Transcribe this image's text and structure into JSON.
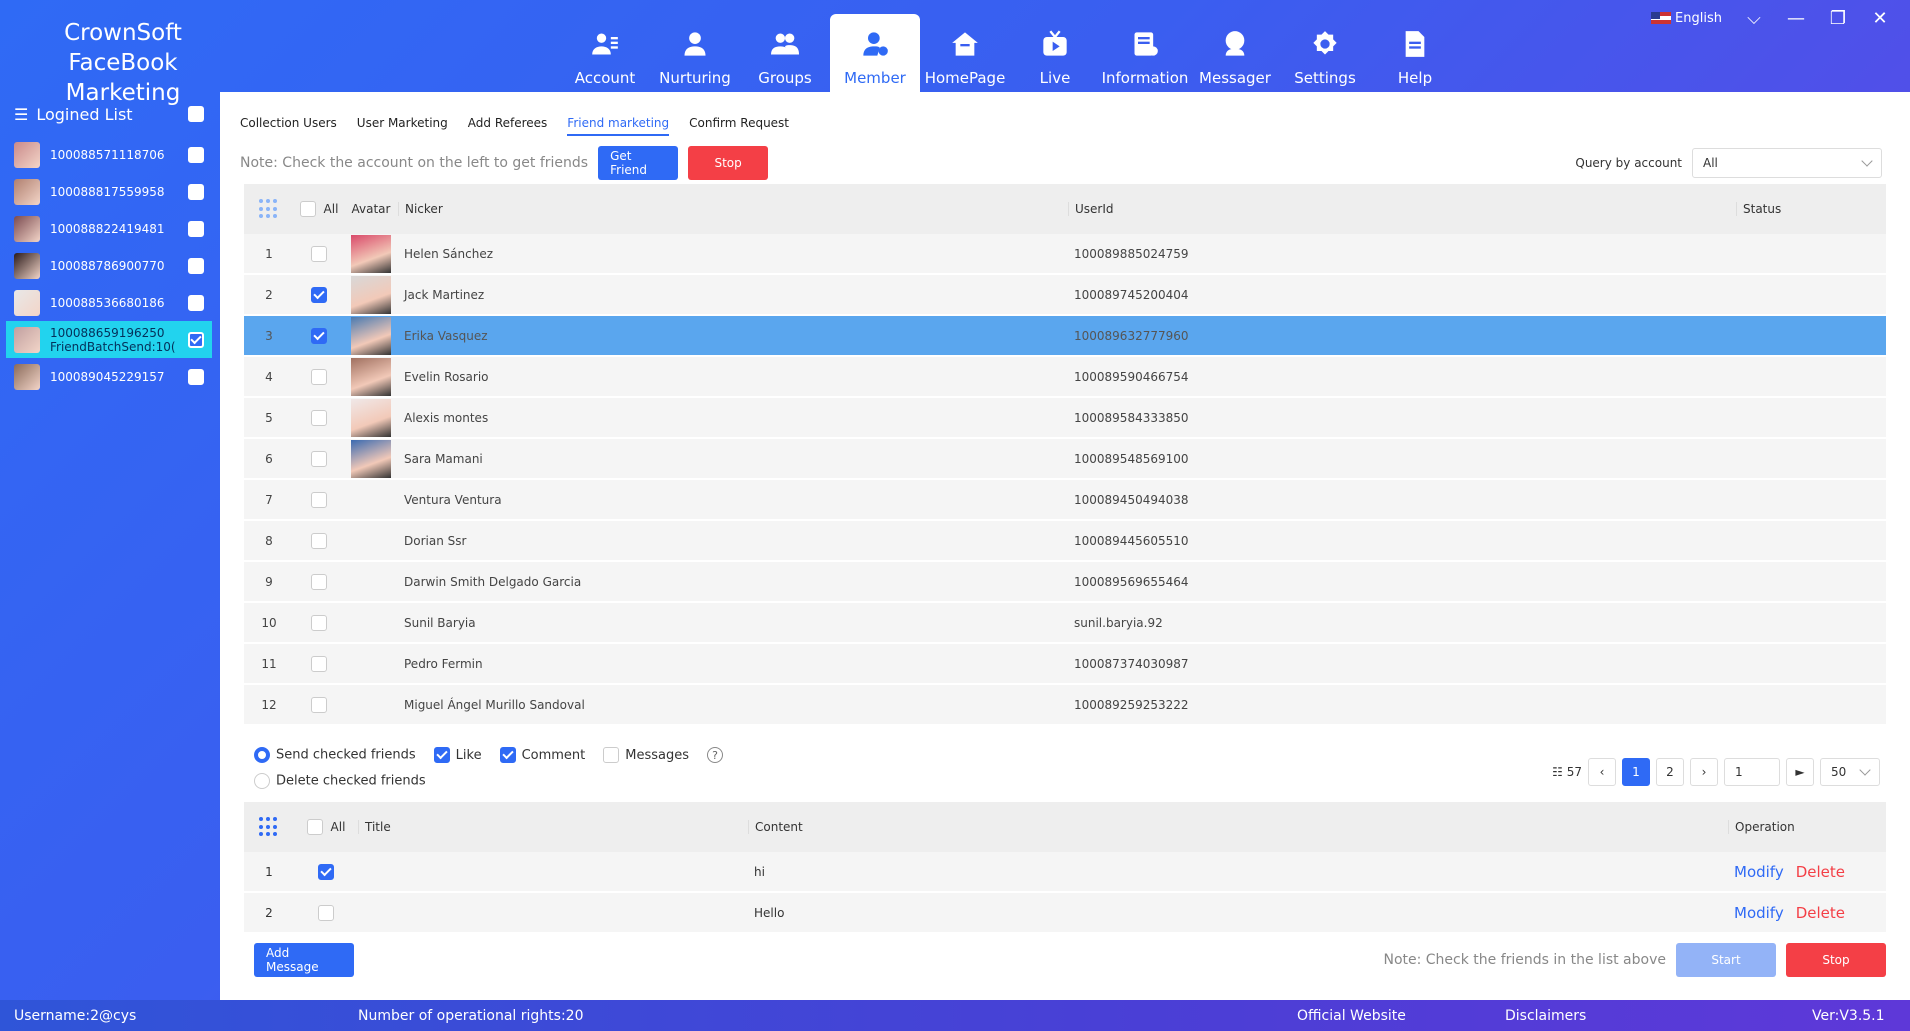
{
  "brand": {
    "line1": "CrownSoft",
    "line2": "FaceBook Marketing"
  },
  "nav": [
    {
      "label": "Account",
      "icon": "account-icon"
    },
    {
      "label": "Nurturing",
      "icon": "user-icon"
    },
    {
      "label": "Groups",
      "icon": "group-icon"
    },
    {
      "label": "Member",
      "icon": "member-icon",
      "active": true
    },
    {
      "label": "HomePage",
      "icon": "home-icon"
    },
    {
      "label": "Live",
      "icon": "live-icon"
    },
    {
      "label": "Information",
      "icon": "info-icon"
    },
    {
      "label": "Messager",
      "icon": "messenger-icon"
    },
    {
      "label": "Settings",
      "icon": "gear-icon"
    },
    {
      "label": "Help",
      "icon": "help-doc-icon"
    }
  ],
  "language": "English",
  "sidebar": {
    "title": "Logined List",
    "accounts": [
      {
        "id": "100088571118706"
      },
      {
        "id": "100088817559958"
      },
      {
        "id": "100088822419481"
      },
      {
        "id": "100088786900770"
      },
      {
        "id": "100088536680186"
      },
      {
        "id": "100088659196250",
        "sub": "FriendBatchSend:10(",
        "selected": true
      },
      {
        "id": "100089045229157"
      }
    ]
  },
  "subtabs": [
    "Collection Users",
    "User Marketing",
    "Add Referees",
    "Friend marketing",
    "Confirm Request"
  ],
  "toolbar": {
    "note": "Note: Check the account on the left to get friends",
    "get_friend": "Get Friend",
    "stop": "Stop",
    "query_label": "Query by account",
    "query_value": "All"
  },
  "friends_table": {
    "headers": {
      "all": "All",
      "avatar": "Avatar",
      "nicker": "Nicker",
      "userid": "UserId",
      "status": "Status"
    },
    "rows": [
      {
        "n": "1",
        "nick": "Helen Sánchez",
        "uid": "100089885024759",
        "checked": false,
        "avatar": true
      },
      {
        "n": "2",
        "nick": "Jack Martinez",
        "uid": "100089745200404",
        "checked": true,
        "avatar": true
      },
      {
        "n": "3",
        "nick": "Erika Vasquez",
        "uid": "100089632777960",
        "checked": true,
        "avatar": true,
        "selected": true
      },
      {
        "n": "4",
        "nick": "Evelin Rosario",
        "uid": "100089590466754",
        "checked": false,
        "avatar": true
      },
      {
        "n": "5",
        "nick": "Alexis montes",
        "uid": "100089584333850",
        "checked": false,
        "avatar": true
      },
      {
        "n": "6",
        "nick": "Sara Mamani",
        "uid": "100089548569100",
        "checked": false,
        "avatar": true
      },
      {
        "n": "7",
        "nick": "Ventura Ventura",
        "uid": "100089450494038",
        "checked": false,
        "avatar": false
      },
      {
        "n": "8",
        "nick": "Dorian Ssr",
        "uid": "100089445605510",
        "checked": false,
        "avatar": false
      },
      {
        "n": "9",
        "nick": "Darwin Smith Delgado Garcia",
        "uid": "100089569655464",
        "checked": false,
        "avatar": false
      },
      {
        "n": "10",
        "nick": "Sunil Baryia",
        "uid": "sunil.baryia.92",
        "checked": false,
        "avatar": false
      },
      {
        "n": "11",
        "nick": "Pedro Fermin",
        "uid": "100087374030987",
        "checked": false,
        "avatar": false
      },
      {
        "n": "12",
        "nick": "Miguel Ángel Murillo Sandoval",
        "uid": "100089259253222",
        "checked": false,
        "avatar": false
      }
    ]
  },
  "options": {
    "send_checked": "Send checked friends",
    "delete_checked": "Delete checked friends",
    "like": "Like",
    "comment": "Comment",
    "messages": "Messages"
  },
  "pager": {
    "total": "57",
    "pages": [
      "1",
      "2"
    ],
    "current": "1",
    "jump": "1",
    "size": "50"
  },
  "messages_table": {
    "headers": {
      "all": "All",
      "title": "Title",
      "content": "Content",
      "operation": "Operation"
    },
    "rows": [
      {
        "n": "1",
        "title": "",
        "content": "hi",
        "checked": true
      },
      {
        "n": "2",
        "title": "",
        "content": "Hello",
        "checked": false
      }
    ],
    "modify": "Modify",
    "delete": "Delete"
  },
  "bottom": {
    "add_message": "Add Message",
    "note": "Note: Check the friends in the list above",
    "start": "Start",
    "stop": "Stop"
  },
  "footer": {
    "username": "Username:2@cys",
    "rights": "Number of operational rights:20",
    "website": "Official Website",
    "disclaimers": "Disclaimers",
    "version": "Ver:V3.5.1"
  }
}
